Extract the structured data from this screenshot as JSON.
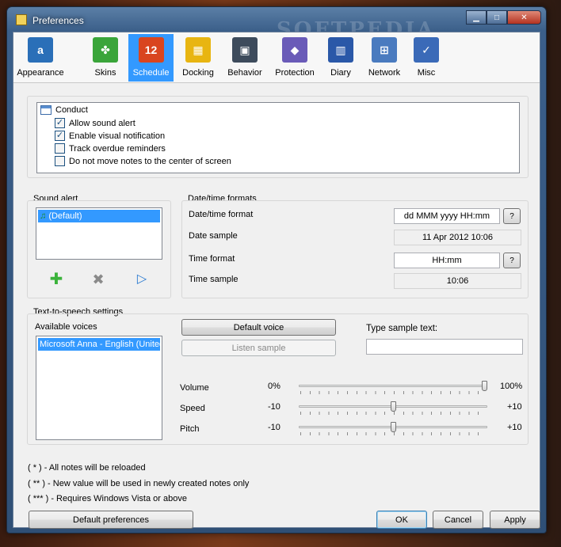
{
  "window": {
    "title": "Preferences",
    "watermark": "SOFTPEDIA"
  },
  "toolbar": {
    "tabs": [
      {
        "label": "Appearance",
        "icon": "appearance-icon",
        "color": "#2a6fb8",
        "glyph": "a",
        "active": false
      },
      {
        "label": "Skins",
        "icon": "puzzle-icon",
        "color": "#3aa53a",
        "glyph": "✤",
        "active": false
      },
      {
        "label": "Schedule",
        "icon": "calendar-icon",
        "color": "#d9451f",
        "glyph": "12",
        "active": true
      },
      {
        "label": "Docking",
        "icon": "docking-icon",
        "color": "#e8b511",
        "glyph": "▦",
        "active": false
      },
      {
        "label": "Behavior",
        "icon": "computer-icon",
        "color": "#3d4b5c",
        "glyph": "▣",
        "active": false
      },
      {
        "label": "Protection",
        "icon": "shield-icon",
        "color": "#6a5bb8",
        "glyph": "◆",
        "active": false
      },
      {
        "label": "Diary",
        "icon": "book-icon",
        "color": "#2a58a8",
        "glyph": "▥",
        "active": false
      },
      {
        "label": "Network",
        "icon": "network-icon",
        "color": "#4a7bbf",
        "glyph": "⊞",
        "active": false
      },
      {
        "label": "Misc",
        "icon": "checklist-icon",
        "color": "#3a6ab8",
        "glyph": "✓",
        "active": false
      }
    ]
  },
  "conduct": {
    "header": "Conduct",
    "options": [
      {
        "label": "Allow sound alert",
        "checked": true
      },
      {
        "label": "Enable visual notification",
        "checked": true
      },
      {
        "label": "Track overdue reminders",
        "checked": false
      },
      {
        "label": "Do not move notes to the center of screen",
        "checked": false
      }
    ]
  },
  "sound_alert": {
    "title": "Sound alert",
    "items": [
      "(Default)"
    ],
    "selected": "(Default)"
  },
  "datetime": {
    "title": "Date/time formats",
    "format_label": "Date/time format",
    "format_value": "dd MMM yyyy HH:mm",
    "sample_label": "Date sample",
    "sample_value": "11 Apr 2012 10:06",
    "time_format_label": "Time format",
    "time_format_value": "HH:mm",
    "time_sample_label": "Time sample",
    "time_sample_value": "10:06",
    "help_label": "?"
  },
  "tts": {
    "title": "Text-to-speech settings",
    "voices_label": "Available voices",
    "voices": [
      "Microsoft Anna - English (United"
    ],
    "default_voice_label": "Default voice",
    "listen_label": "Listen sample",
    "sample_text_label": "Type sample text:",
    "sample_text_value": "",
    "volume": {
      "label": "Volume",
      "min": "0%",
      "max": "100%",
      "value": 1.0
    },
    "speed": {
      "label": "Speed",
      "min": "-10",
      "max": "+10",
      "value": 0.5
    },
    "pitch": {
      "label": "Pitch",
      "min": "-10",
      "max": "+10",
      "value": 0.5
    }
  },
  "notes": [
    "( * ) - All notes will be reloaded",
    "( ** ) - New value will be used in newly created notes only",
    "( *** ) - Requires Windows Vista or above"
  ],
  "buttons": {
    "default_prefs": "Default preferences",
    "ok": "OK",
    "cancel": "Cancel",
    "apply": "Apply"
  }
}
